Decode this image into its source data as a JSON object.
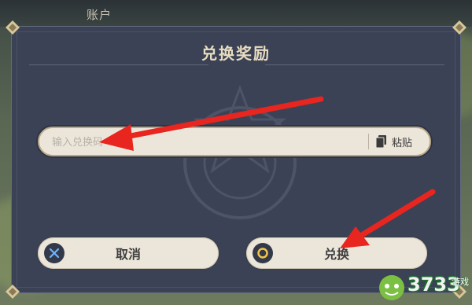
{
  "top_tab": {
    "label": "账户"
  },
  "dialog": {
    "title": "兑换奖励",
    "input": {
      "placeholder": "输入兑换码",
      "value": ""
    },
    "paste_label": "粘贴",
    "cancel_label": "取消",
    "confirm_label": "兑换"
  },
  "colors": {
    "dialog_bg": "#3b4255",
    "title": "#e8dcc0",
    "button_bg": "#ece6da",
    "arrow": "#e8251f"
  },
  "watermark": {
    "number": "3733",
    "suffix": "游戏"
  }
}
